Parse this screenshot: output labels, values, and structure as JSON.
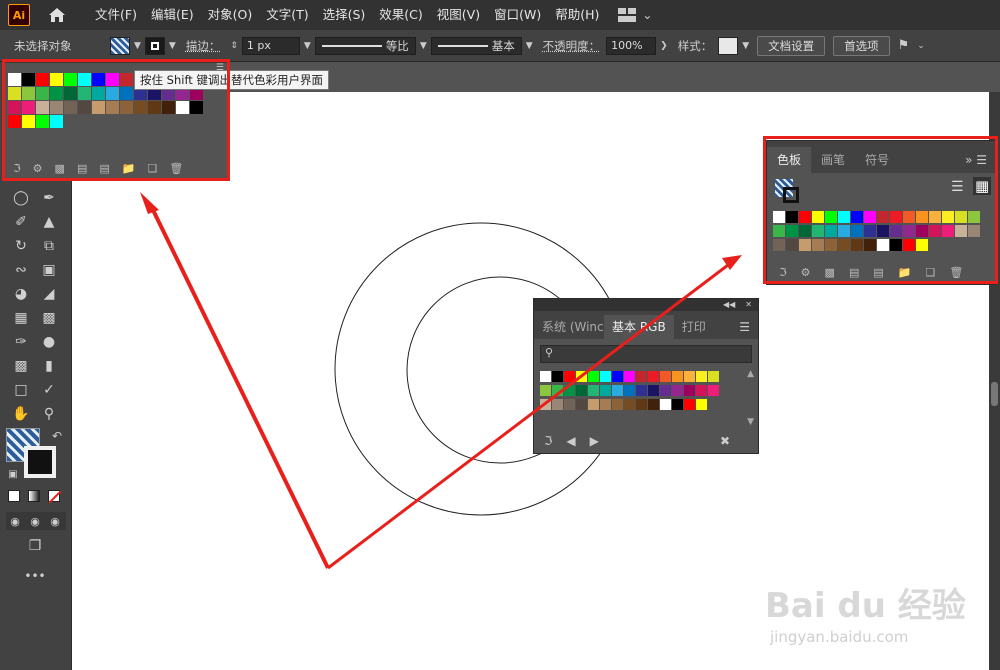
{
  "app": {
    "logo": "Ai"
  },
  "menu": [
    "文件(F)",
    "编辑(E)",
    "对象(O)",
    "文字(T)",
    "选择(S)",
    "效果(C)",
    "视图(V)",
    "窗口(W)",
    "帮助(H)"
  ],
  "control_bar": {
    "no_selection": "未选择对象",
    "stroke_label": "描边：",
    "stroke_value": "1 px",
    "stroke_profile": "等比",
    "brush": "基本",
    "opacity_label": "不透明度：",
    "opacity_value": "100%",
    "style_label": "样式：",
    "doc_setup": "文档设置",
    "preferences": "首选项"
  },
  "tooltip": "按住 Shift 键调出替代色彩用户界面",
  "swatches_panel": {
    "tabs": [
      "色板",
      "画笔",
      "符号"
    ]
  },
  "float_panel": {
    "tabs": [
      "系统 (Winc",
      "基本 RGB",
      "打印"
    ]
  },
  "watermark": {
    "brand": "Bai du 经验",
    "url": "jingyan.baidu.com"
  },
  "colors": {
    "annotation_red": "#e8201c",
    "ui_dark": "#323232",
    "ui_mid": "#424242",
    "ui_panel": "#535353"
  },
  "swatch_colors": [
    "#ffffff",
    "#000000",
    "#ff0000",
    "#ffff00",
    "#00ff00",
    "#00ffff",
    "#0000ff",
    "#ff00ff",
    "#c1272d",
    "#ed1c24",
    "#f15a24",
    "#f7931e",
    "#fbb03b",
    "#fcee21",
    "#d9e021",
    "#8cc63f",
    "#39b54a",
    "#009245",
    "#006837",
    "#22b573",
    "#00a99d",
    "#29abe2",
    "#0071bc",
    "#2e3192",
    "#1b1464",
    "#662d91",
    "#93278f",
    "#9e005d",
    "#d4145a",
    "#ed1e79",
    "#c7b299",
    "#998675",
    "#736357",
    "#534741",
    "#c69c6d",
    "#a67c52",
    "#8c6239",
    "#754c24",
    "#603813",
    "#42210b"
  ]
}
